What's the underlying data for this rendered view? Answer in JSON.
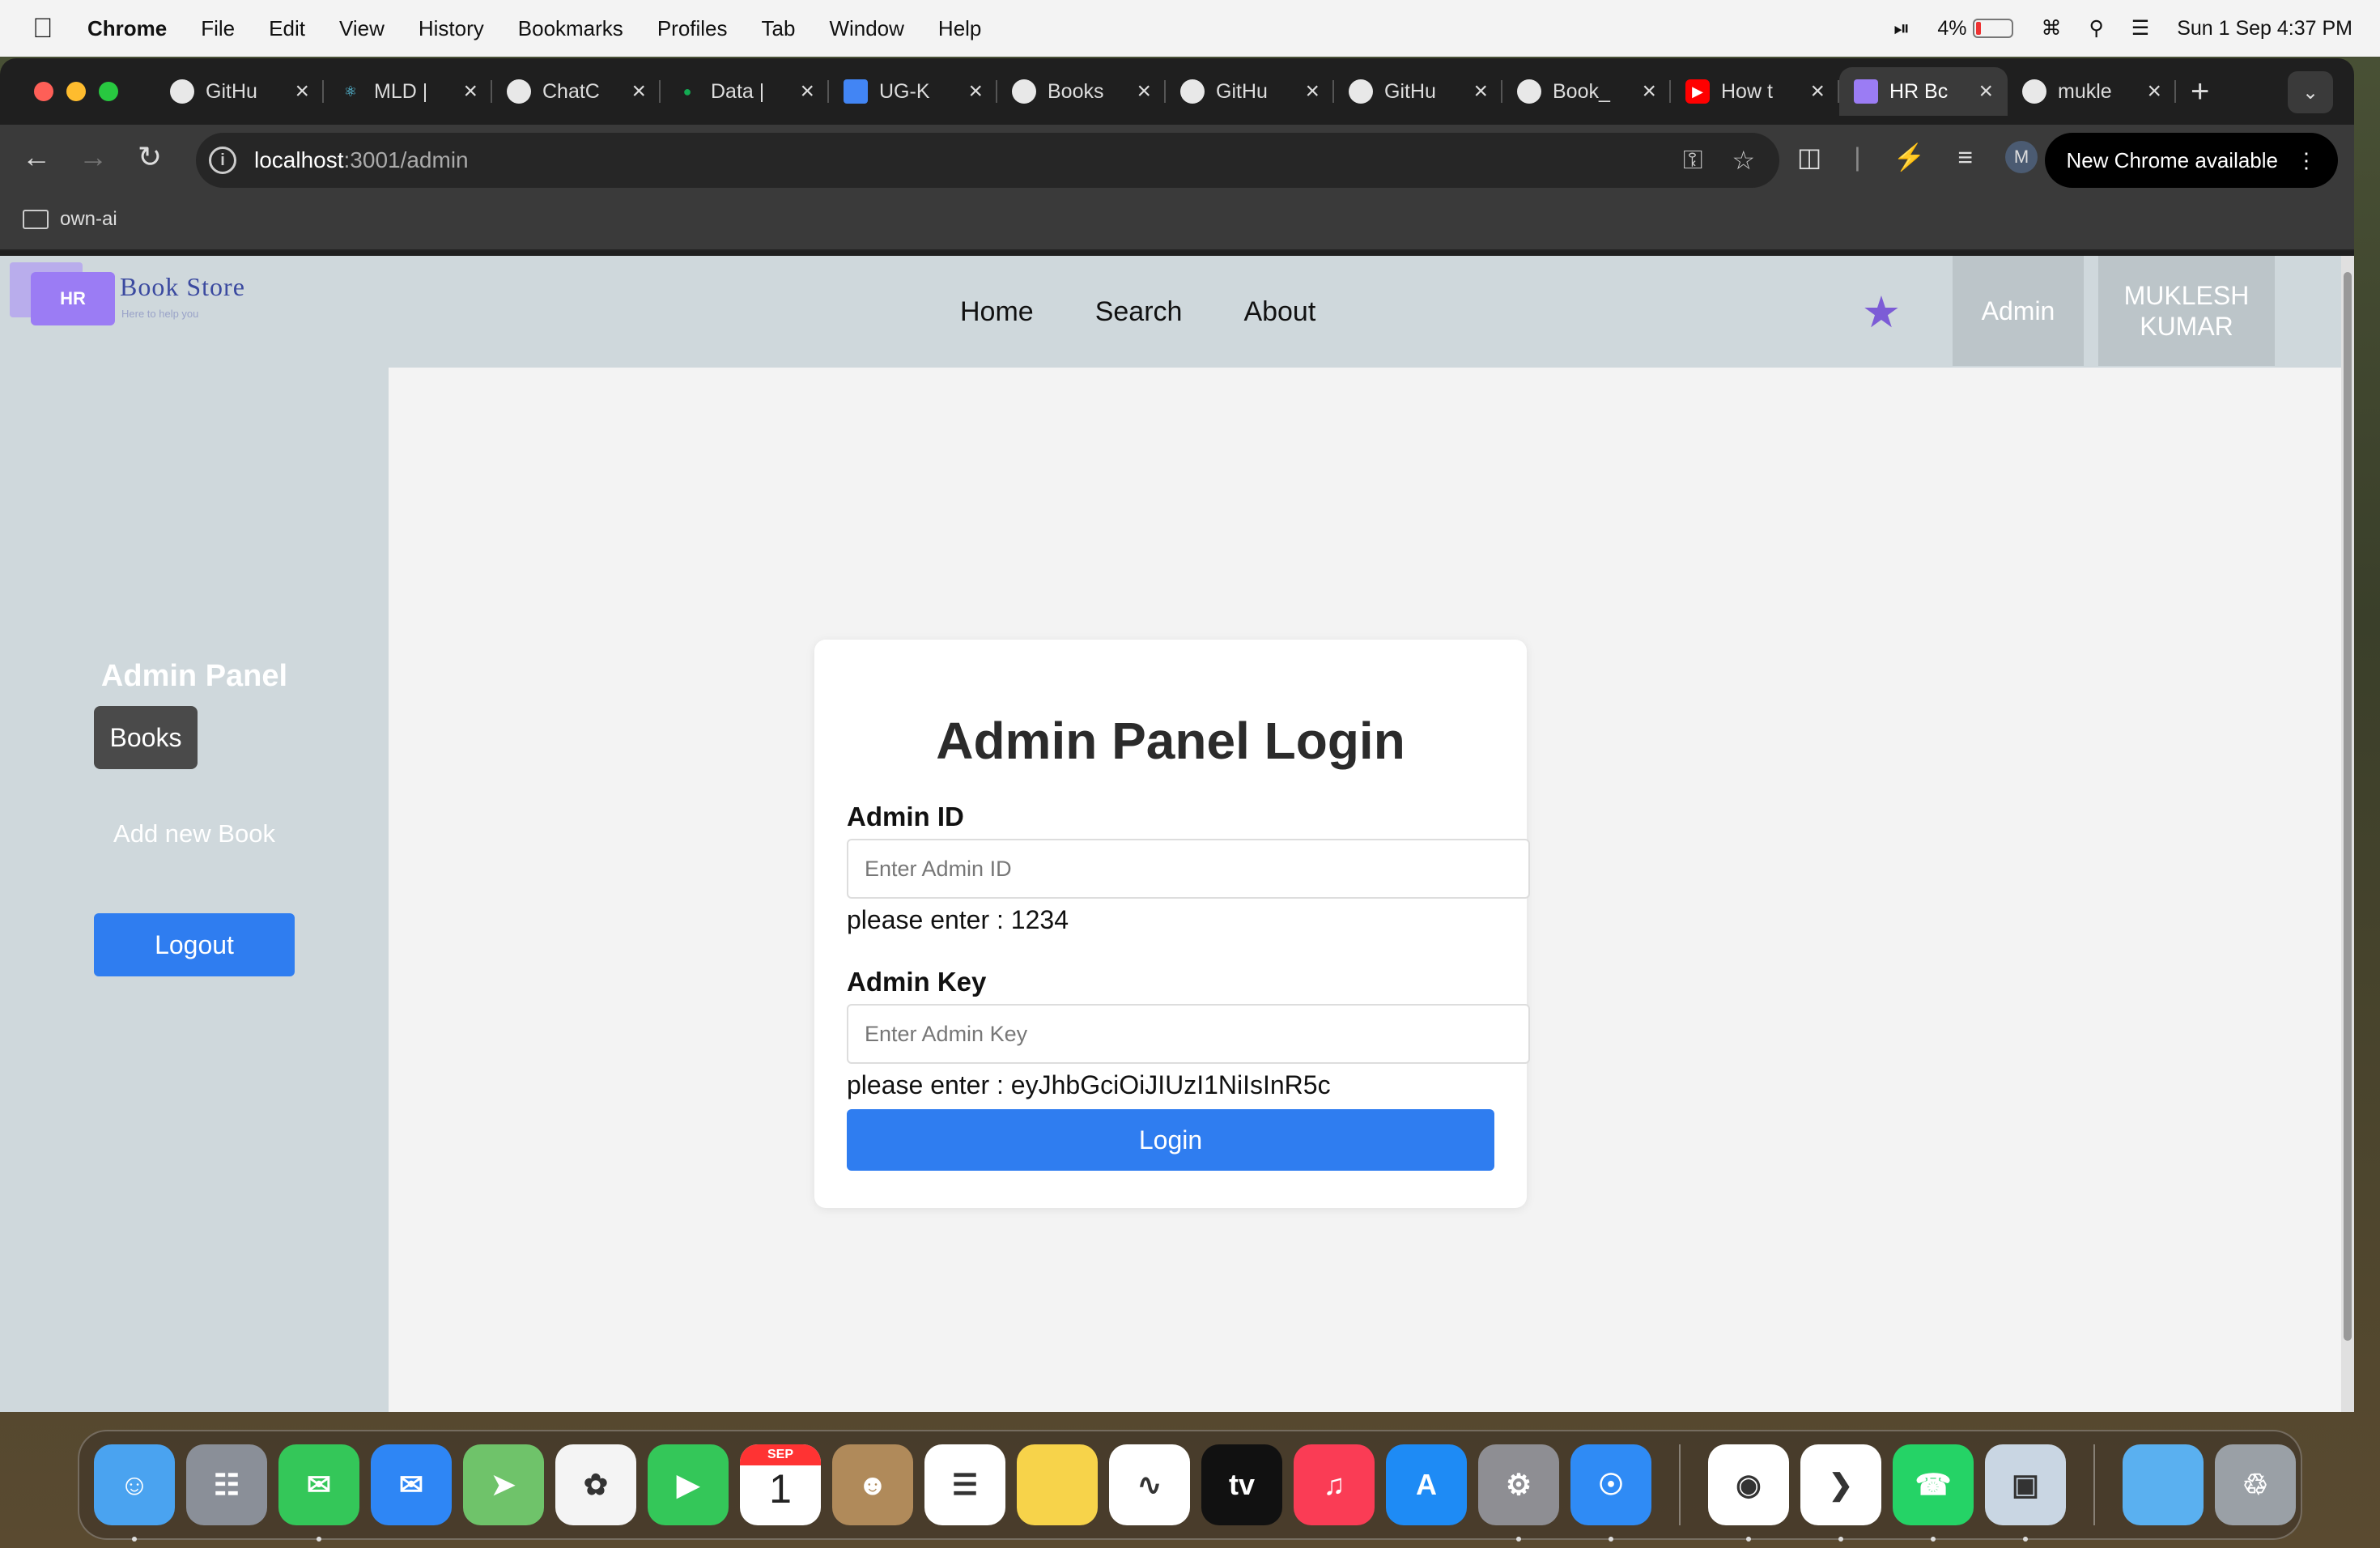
{
  "menubar": {
    "app": "Chrome",
    "items": [
      "File",
      "Edit",
      "View",
      "History",
      "Bookmarks",
      "Profiles",
      "Tab",
      "Window",
      "Help"
    ],
    "battery": "4%",
    "datetime": "Sun 1 Sep  4:37 PM"
  },
  "tabs": [
    {
      "label": "GitHu",
      "icon": "github-icon"
    },
    {
      "label": "MLD |",
      "icon": "react-icon"
    },
    {
      "label": "ChatC",
      "icon": "chatgpt-icon"
    },
    {
      "label": "Data |",
      "icon": "mongodb-leaf-icon"
    },
    {
      "label": "UG-K",
      "icon": "google-docs-icon"
    },
    {
      "label": "Books",
      "icon": "github-icon"
    },
    {
      "label": "GitHu",
      "icon": "github-icon"
    },
    {
      "label": "GitHu",
      "icon": "github-icon"
    },
    {
      "label": "Book_",
      "icon": "github-icon"
    },
    {
      "label": "How t",
      "icon": "youtube-icon"
    },
    {
      "label": "HR Bc",
      "icon": "hr-bookstore-icon",
      "active": true
    },
    {
      "label": "mukle",
      "icon": "github-icon"
    }
  ],
  "address": {
    "host": "localhost",
    "path": ":3001/admin"
  },
  "profile_initial": "M",
  "update_label": "New Chrome available",
  "bookmarks": [
    {
      "label": "own-ai"
    }
  ],
  "site": {
    "logo_badge": "HR",
    "logo_title": "Book Store",
    "logo_tagline": "Here to help you",
    "nav": [
      "Home",
      "Search",
      "About"
    ],
    "admin_label": "Admin",
    "user_label": "MUKLESH KUMAR",
    "accent": "#2f7df0",
    "star_color": "#7c5cd6"
  },
  "sidebar": {
    "title": "Admin Panel",
    "books": "Books",
    "add": "Add new Book",
    "logout": "Logout"
  },
  "login": {
    "heading": "Admin Panel Login",
    "id_label": "Admin ID",
    "id_placeholder": "Enter Admin ID",
    "id_hint": "please enter : 1234",
    "key_label": "Admin Key",
    "key_placeholder": "Enter Admin Key",
    "key_hint": "please enter : eyJhbGciOiJIUzI1NiIsInR5c",
    "button": "Login"
  },
  "dock": [
    {
      "name": "finder",
      "color": "#4aa3f0"
    },
    {
      "name": "launchpad",
      "color": "#8a8f98"
    },
    {
      "name": "messages",
      "color": "#34c759"
    },
    {
      "name": "mail",
      "color": "#2e86f5"
    },
    {
      "name": "maps",
      "color": "#6fc36a"
    },
    {
      "name": "photos",
      "color": "#f4f4f4"
    },
    {
      "name": "facetime",
      "color": "#34c759"
    },
    {
      "name": "calendar",
      "color": "#ffffff",
      "month": "SEP",
      "day": "1"
    },
    {
      "name": "contacts",
      "color": "#b08a5a"
    },
    {
      "name": "reminders",
      "color": "#ffffff"
    },
    {
      "name": "notes",
      "color": "#f7d34a"
    },
    {
      "name": "freeform",
      "color": "#ffffff"
    },
    {
      "name": "tv",
      "color": "#111111",
      "label": "tv"
    },
    {
      "name": "music",
      "color": "#fa3c55"
    },
    {
      "name": "app-store",
      "color": "#1e8bf5"
    },
    {
      "name": "system-settings",
      "color": "#8e8e93"
    },
    {
      "name": "safari",
      "color": "#2f8bf5"
    },
    {
      "name": "chrome",
      "color": "#ffffff"
    },
    {
      "name": "vscode",
      "color": "#ffffff"
    },
    {
      "name": "whatsapp",
      "color": "#25d366"
    },
    {
      "name": "preview",
      "color": "#c9d6e3"
    },
    {
      "name": "folder",
      "color": "#5ab0f0"
    },
    {
      "name": "trash",
      "color": "#9aa0a6"
    }
  ]
}
